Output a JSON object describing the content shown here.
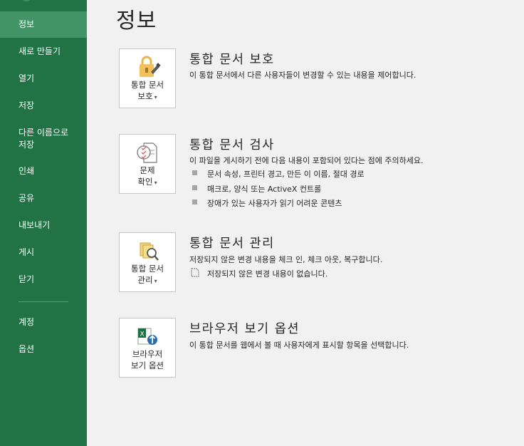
{
  "sidebar": {
    "items": [
      {
        "label": "정보",
        "active": true
      },
      {
        "label": "새로 만들기"
      },
      {
        "label": "열기"
      },
      {
        "label": "저장"
      },
      {
        "label": "다른 이름으로\n저장"
      },
      {
        "label": "인쇄"
      },
      {
        "label": "공유"
      },
      {
        "label": "내보내기"
      },
      {
        "label": "게시"
      },
      {
        "label": "닫기"
      },
      {
        "label": "계정"
      },
      {
        "label": "옵션"
      }
    ]
  },
  "page": {
    "title": "정보"
  },
  "sections": {
    "protect": {
      "button_line1": "통합 문서",
      "button_line2": "보호",
      "title": "통합 문서 보호",
      "desc": "이 통합 문서에서 다른 사용자들이 변경할 수 있는 내용을 제어합니다."
    },
    "inspect": {
      "button_line1": "문제",
      "button_line2": "확인",
      "title": "통합 문서 검사",
      "desc": "이 파일을 게시하기 전에 다음 내용이 포함되어 있다는 점에 주의하세요.",
      "bullets": [
        "문서 속성, 프린터 경고, 만든 이 이름, 절대 경로",
        "매크로, 양식 또는 ActiveX 컨트롤",
        "장애가 있는 사용자가 읽기 어려운 콘텐츠"
      ]
    },
    "manage": {
      "button_line1": "통합 문서",
      "button_line2": "관리",
      "title": "통합 문서 관리",
      "desc": "저장되지 않은 변경 내용을 체크 인, 체크 아웃, 복구합니다.",
      "note": "저장되지 않은 변경 내용이 없습니다."
    },
    "browser": {
      "button_line1": "브라우저",
      "button_line2": "보기 옵션",
      "title": "브라우저 보기 옵션",
      "desc": "이 통합 문서를 웹에서 볼 때 사용자에게 표시할 항목을 선택합니다."
    }
  },
  "colors": {
    "sidebar": "#217346",
    "active": "#439467",
    "background": "#f1f1f1"
  }
}
